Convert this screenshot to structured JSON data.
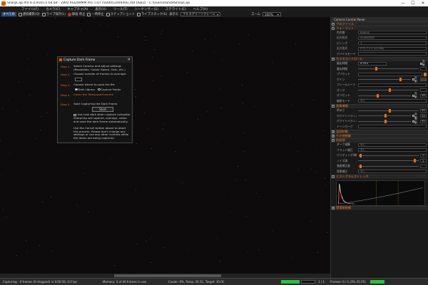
{
  "titlebar": {
    "title": "SharpCap Pro 4.0.9165.0 64 bit - ZWO ASI294MM Pro (TOTTVD0051000000_std USB3) - C:\\Users\\RandHSharpCap",
    "minimize": "—",
    "maximize": "☐",
    "close": "✕"
  },
  "menu": [
    "ファイル(F)",
    "カメラ(C)",
    "キャプチャ(A)",
    "表示(V)",
    "ツール(T)",
    "シーケンサー(S)",
    "ステライト(E)",
    "ヘルプ(H)"
  ],
  "toolbar": {
    "items": [
      "すべての",
      "連続撮影(Q)",
      "ライブ保存(L)",
      "録画 停止",
      "一時停止",
      "スナップショット",
      "ライブスタック(S)"
    ],
    "view_label": "表示モ",
    "view_select": "フルスクリーンフレーム",
    "zoom_label": "ズーム",
    "zoom_select": "100%"
  },
  "dialog": {
    "title": "Capture Dark Frame",
    "close": "✕",
    "steps": [
      {
        "label": "Step 1.",
        "text": "Select Camera and adjust settings (Resolution, Colour Space, Gain, etc.)"
      },
      {
        "label": "Step 2.",
        "text": "Choose number of frames to average:"
      },
      {
        "label": "Step 3.",
        "text": "Choose where to save the file"
      },
      {
        "label": "Step 4.",
        "text": "Cover the Telescope/Camera"
      },
      {
        "label": "Step 5.",
        "text": "Start Capturing the Dark Frame"
      }
    ],
    "frames_value": "",
    "radio_library": "Dark Library",
    "radio_folder": "Capture Folder",
    "start_button": "Start",
    "checkbox_text": "Use new dark when capture complete",
    "info_text": "SharpCap will capture, average, name and save the dark frame automatically.",
    "cancel_text": "Use the Cancel button above to abort the process. Please don't change any settings or use any other controls while the darks are being captured."
  },
  "panel": {
    "header": "Camera Control Panel",
    "sections": {
      "profile": "プロファイル",
      "format": "フォーマット",
      "camera_controls": "カメラコントロール",
      "image_controls": "画像補償",
      "thermal": "温度制御",
      "misc": "その他制御",
      "preprocess": "前処理",
      "histogram": "ヒストグラムストレッチ",
      "testing": "望遠鏡制御"
    },
    "format_rows": [
      {
        "label": "色空間",
        "value": "RAW16"
      },
      {
        "label": "出力形式",
        "value": "4144x2822"
      },
      {
        "label": "ビニング",
        "value": "1"
      },
      {
        "label": "出力形式",
        "value": "FITSファイル(*.fits)"
      },
      {
        "label": "デバイスモード",
        "value": ""
      }
    ],
    "camera_rows": [
      {
        "label": "露出時間",
        "value": "0.29 s",
        "check": "自動"
      },
      {
        "label": "露出時間",
        "value": "",
        "check": ""
      },
      {
        "label": "プリセット",
        "value": "",
        "check": ""
      },
      {
        "label": "ゲイン",
        "value": "470",
        "check": "自動"
      },
      {
        "label": "フレームレート",
        "value": "",
        "check": ""
      },
      {
        "label": "ガンマ",
        "value": "",
        "check": ""
      },
      {
        "label": "オフセット",
        "value": "50",
        "check": "自動"
      },
      {
        "label": "偏差モード",
        "value": "なし",
        "check": ""
      }
    ],
    "image_rows": [
      {
        "label": "明るさ",
        "value": "50"
      },
      {
        "label": "ホワイトバランス(R)",
        "value": "50",
        "check": "自動"
      },
      {
        "label": "ホワイトバランス(B)",
        "value": "50",
        "check": "自動"
      },
      {
        "label": "トーンカーブ",
        "value": ""
      }
    ],
    "pre_rows": [
      {
        "label": "ダーク減算",
        "value": "なし"
      },
      {
        "label": "フラット補正",
        "value": "なし"
      },
      {
        "label": "バンディング抑制",
        "value": "0"
      },
      {
        "label": "ノイズ減",
        "value": "2"
      },
      {
        "label": "強度補正量",
        "value": ""
      },
      {
        "label": "背景補正",
        "value": "なし"
      }
    ]
  },
  "statusbar": {
    "capturing": "Capturing - 0 frames (0 dropped) in 0:00:50, 0.0 fps",
    "memory": "Memory: 3 of 46 frames in use",
    "cooler": "Cooler: 0%, Temp: 26.5C, Target: 10.0C",
    "frames": "Frames: 0 / 1 (3% 22:25)",
    "counter": "1 / 1"
  }
}
